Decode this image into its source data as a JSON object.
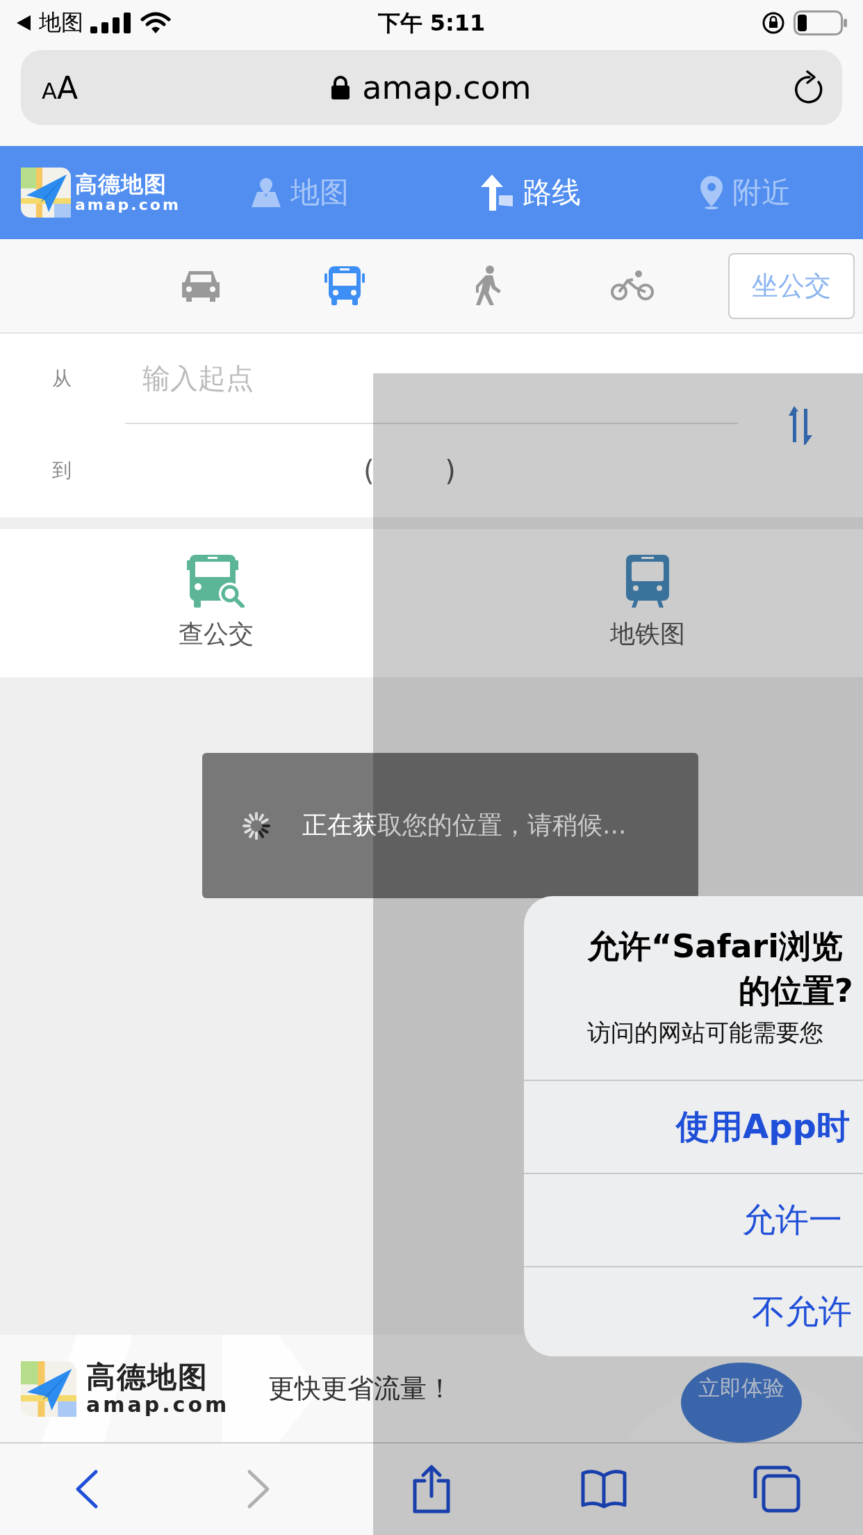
{
  "status_bar": {
    "back_app": "地图",
    "time": "下午 5:11"
  },
  "address_bar": {
    "text_size": "AA",
    "url": "amap.com"
  },
  "header": {
    "logo": {
      "name": "高德地图",
      "domain": "amap.com"
    },
    "tabs": [
      {
        "label": "地图",
        "kind": "map",
        "selected": false
      },
      {
        "label": "路线",
        "kind": "arrow",
        "selected": true
      },
      {
        "label": "附近",
        "kind": "pin",
        "selected": false
      }
    ]
  },
  "modes": [
    {
      "kind": "car",
      "selected": false
    },
    {
      "kind": "bus",
      "selected": true
    },
    {
      "kind": "walk",
      "selected": false
    },
    {
      "kind": "bike",
      "selected": false
    }
  ],
  "ride_button": "坐公交",
  "route": {
    "from_label": "从",
    "from_placeholder": "输入起点",
    "to_label": "到",
    "to_value": "(        )"
  },
  "tools": [
    {
      "label": "查公交",
      "kind": "bus-search"
    },
    {
      "label": "地铁图",
      "kind": "metro"
    }
  ],
  "toast": {
    "text": "正在获取您的位置，请稍候..."
  },
  "dialog": {
    "title_lines": [
      "允许“Safari浏览",
      "的位置?"
    ],
    "message": "访问的网站可能需要您",
    "buttons": [
      {
        "label": "使用App时",
        "bold": true
      },
      {
        "label": "允许一",
        "bold": false
      },
      {
        "label": "不允许",
        "bold": false
      }
    ]
  },
  "banner": {
    "name": "高德地图",
    "domain": "amap.com",
    "slogan": "更快更省流量！",
    "cta": "立即体验"
  },
  "toolbar": [
    {
      "kind": "back",
      "disabled": false
    },
    {
      "kind": "forward",
      "disabled": true
    },
    {
      "kind": "share",
      "disabled": false
    },
    {
      "kind": "bookmarks",
      "disabled": false
    },
    {
      "kind": "tabs",
      "disabled": false
    }
  ]
}
